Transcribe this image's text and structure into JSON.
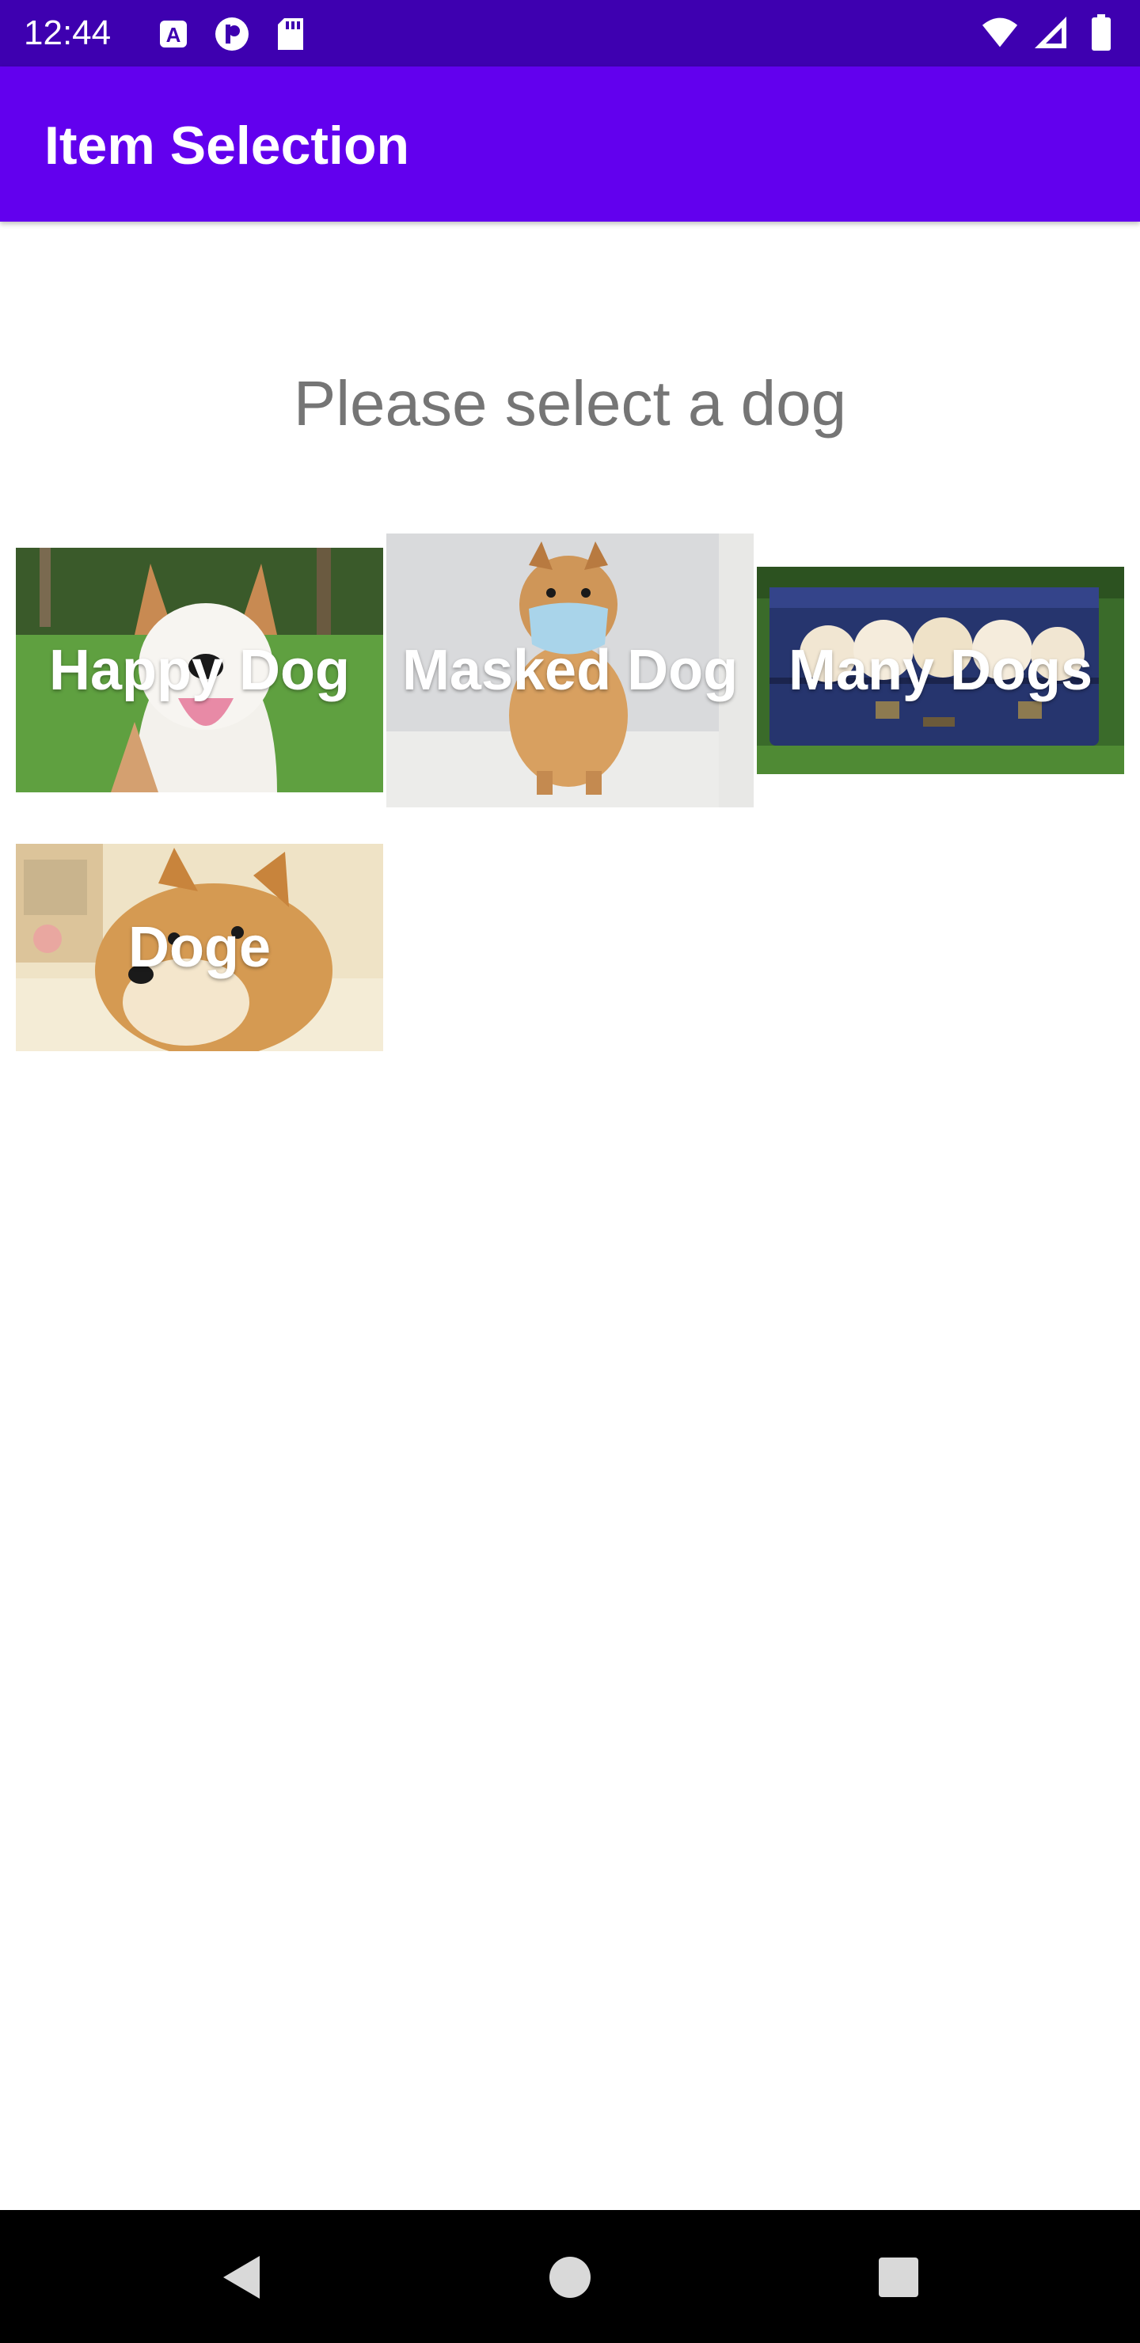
{
  "status_bar": {
    "time": "12:44",
    "left_icons": [
      "text-a-icon",
      "p-circle-icon",
      "sd-card-icon"
    ],
    "right_icons": [
      "wifi-icon",
      "signal-icon",
      "battery-icon"
    ]
  },
  "app_bar": {
    "title": "Item Selection",
    "color": "#6200ee"
  },
  "prompt": "Please select a dog",
  "dogs": [
    {
      "label": "Happy Dog"
    },
    {
      "label": "Masked Dog"
    },
    {
      "label": "Many Dogs"
    },
    {
      "label": "Doge"
    }
  ],
  "nav_bar": {
    "buttons": [
      "back-icon",
      "home-icon",
      "recents-icon"
    ]
  }
}
